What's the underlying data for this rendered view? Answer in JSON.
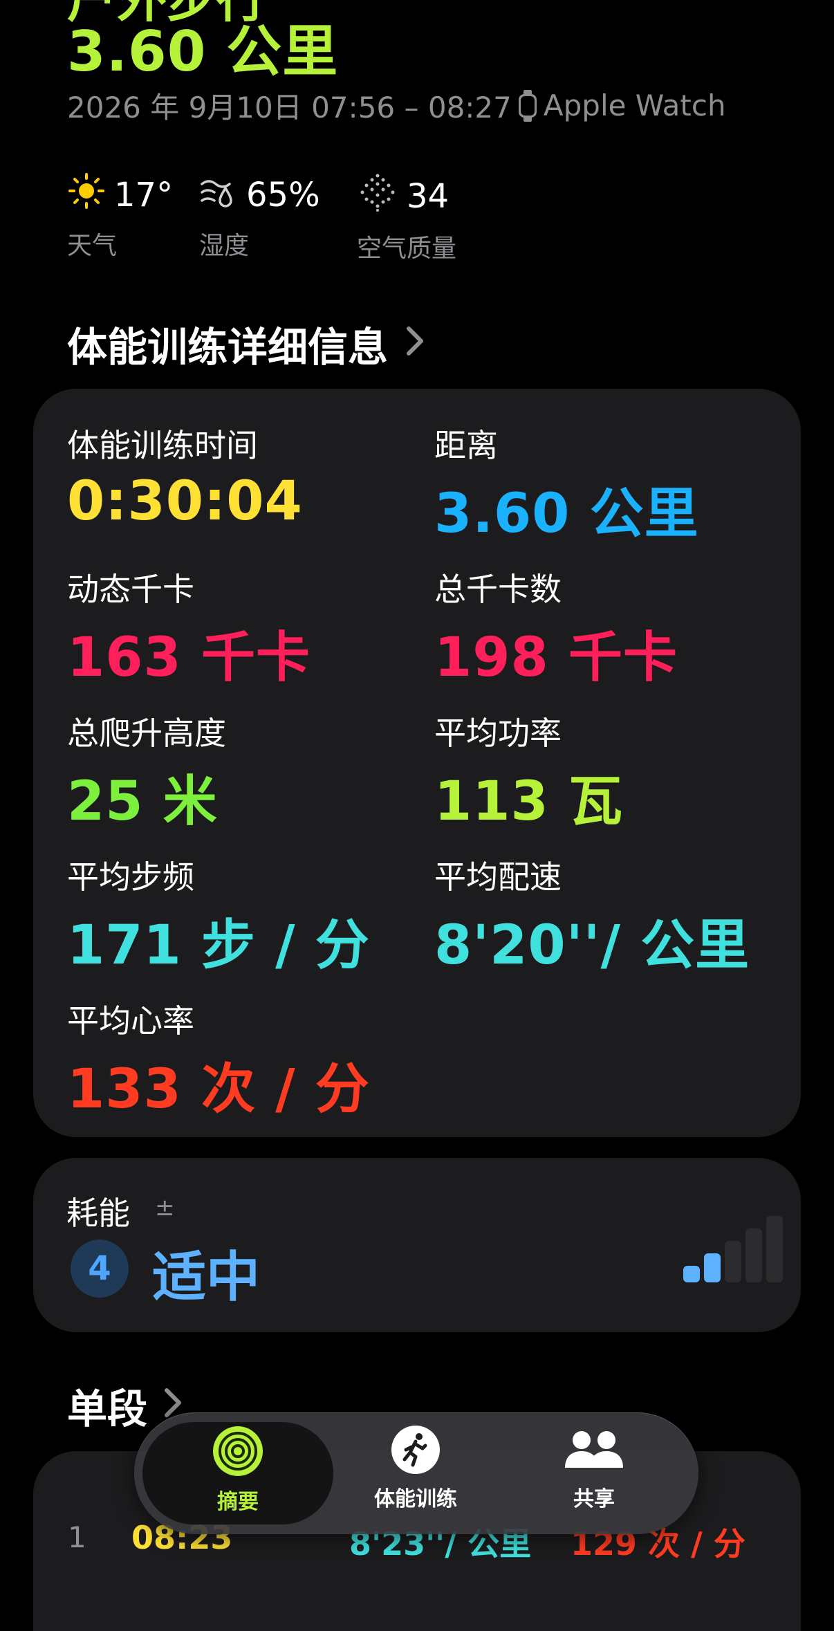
{
  "workout": {
    "title_partial": "户外步行",
    "distance": "3.60 公里",
    "date_range": "2026 年 9月10日 07:56 – 08:27",
    "device": "Apple Watch"
  },
  "conditions": [
    {
      "icon": "sun-icon",
      "value": "17°",
      "label": "天气"
    },
    {
      "icon": "humidity-icon",
      "value": "65%",
      "label": "湿度"
    },
    {
      "icon": "air-quality-icon",
      "value": "34",
      "label": "空气质量"
    }
  ],
  "details": {
    "header": "体能训练详细信息",
    "metrics": [
      {
        "label": "体能训练时间",
        "value": "0:30:04",
        "color": "#ffe034"
      },
      {
        "label": "距离",
        "value": "3.60 公里",
        "color": "#1ab2ff"
      },
      {
        "label": "动态千卡",
        "value": "163 千卡",
        "color": "#ff1f5a"
      },
      {
        "label": "总千卡数",
        "value": "198 千卡",
        "color": "#ff1f5a"
      },
      {
        "label": "总爬升高度",
        "value": "25 米",
        "color": "#7cf03c"
      },
      {
        "label": "平均功率",
        "value": "113 瓦",
        "color": "#b6f23a"
      },
      {
        "label": "平均步频",
        "value": "171 步 / 分",
        "color": "#3fe0de"
      },
      {
        "label": "平均配速",
        "value": "8'20''/ 公里",
        "color": "#3fe0de"
      },
      {
        "label": "平均心率",
        "value": "133 次 / 分",
        "color": "#ff3b22"
      }
    ]
  },
  "effort": {
    "label": "耗能",
    "pm_symbol": "±",
    "level": "4",
    "level_text": "适中",
    "meter_filled": 2,
    "meter_total": 5,
    "color": "#5db1ff"
  },
  "splits": {
    "header": "单段",
    "rows": [
      {
        "index": "1",
        "time": "08:23",
        "pace": "8'23''/ 公里",
        "hr": "129 次 / 分"
      }
    ]
  },
  "tabbar": {
    "tabs": [
      {
        "label": "摘要",
        "icon": "activity-rings-icon",
        "active": true
      },
      {
        "label": "体能训练",
        "icon": "running-figure-icon",
        "active": false
      },
      {
        "label": "共享",
        "icon": "people-icon",
        "active": false
      }
    ]
  },
  "colors": {
    "accent_green": "#b6f23a",
    "card": "#1c1c1e"
  }
}
